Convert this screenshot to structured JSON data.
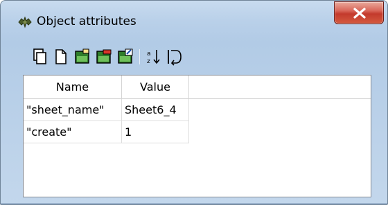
{
  "window": {
    "title": "Object attributes",
    "close_glyph": "X"
  },
  "toolbar": {
    "buttons": [
      {
        "icon": "copy-icon"
      },
      {
        "icon": "new-document-icon"
      },
      {
        "icon": "add-attribute-icon"
      },
      {
        "icon": "remove-attribute-icon"
      },
      {
        "icon": "edit-attribute-icon"
      },
      {
        "icon": "sort-az-icon"
      },
      {
        "icon": "refresh-icon"
      }
    ]
  },
  "table": {
    "columns": [
      "Name",
      "Value"
    ],
    "rows": [
      {
        "name": "\"sheet_name\"",
        "value": "Sheet6_4"
      },
      {
        "name": "\"create\"",
        "value": "1"
      }
    ]
  },
  "colors": {
    "title_bar": "#b9d0e9",
    "close_button": "#c33a2c",
    "grid_border": "#dedede"
  }
}
